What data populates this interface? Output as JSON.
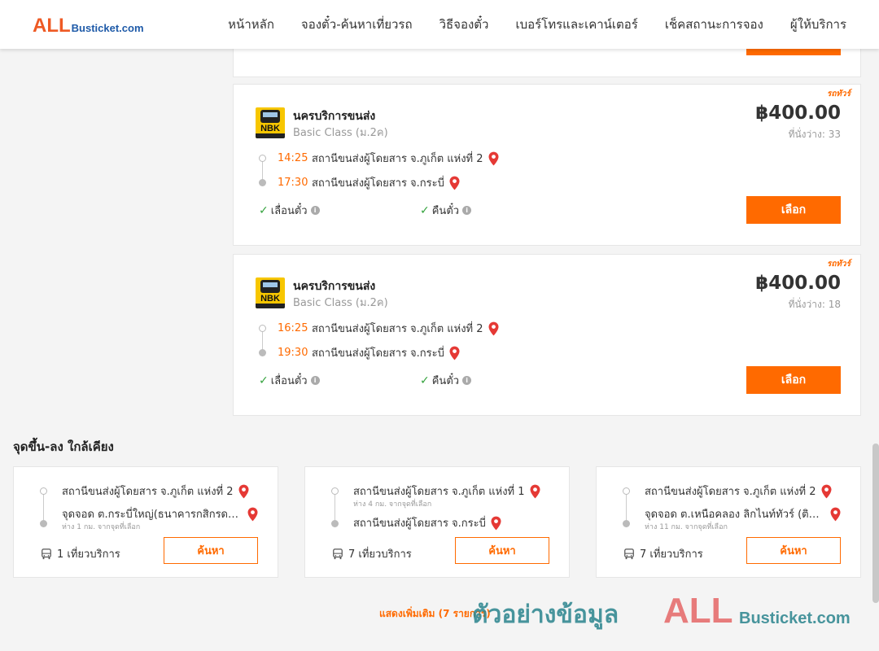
{
  "header": {
    "logo_all": "ALL",
    "logo_rest": "Busticket.com",
    "nav": [
      "หน้าหลัก",
      "จองตั๋ว-ค้นหาเที่ยวรถ",
      "วิธีจองตั๋ว",
      "เบอร์โทรและเคาน์เตอร์",
      "เช็คสถานะการจอง",
      "ผู้ให้บริการ"
    ]
  },
  "trips": [
    {
      "badge": "รถทัวร์",
      "operator": "นครบริการขนส่ง",
      "logo_text": "NBK",
      "bus_class": "Basic Class (ม.2ค)",
      "price": "฿400.00",
      "seats": "ที่นั่งว่าง: 33",
      "depart_time": "14:25",
      "depart_place": "สถานีขนส่งผู้โดยสาร จ.ภูเก็ต แห่งที่ 2",
      "arrive_time": "17:30",
      "arrive_place": "สถานีขนส่งผู้โดยสาร จ.กระบี่",
      "feature_1": "เลื่อนตั๋ว",
      "feature_2": "คืนตั๋ว",
      "select_label": "เลือก"
    },
    {
      "badge": "รถทัวร์",
      "operator": "นครบริการขนส่ง",
      "logo_text": "NBK",
      "bus_class": "Basic Class (ม.2ค)",
      "price": "฿400.00",
      "seats": "ที่นั่งว่าง: 18",
      "depart_time": "16:25",
      "depart_place": "สถานีขนส่งผู้โดยสาร จ.ภูเก็ต แห่งที่ 2",
      "arrive_time": "19:30",
      "arrive_place": "สถานีขนส่งผู้โดยสาร จ.กระบี่",
      "feature_1": "เลื่อนตั๋ว",
      "feature_2": "คืนตั๋ว",
      "select_label": "เลือก"
    }
  ],
  "nearby": {
    "title": "จุดขึ้น-ลง ใกล้เคียง",
    "cards": [
      {
        "from": "สถานีขนส่งผู้โดยสาร จ.ภูเก็ต แห่งที่ 2",
        "from_dist": "",
        "to": "จุดจอด ต.กระบี่ใหญ่(ธนาคารกสิกรดลาดเก่า)",
        "to_dist": "ห่าง 1 กม. จากจุดที่เลือก",
        "trips": "1 เที่ยวบริการ",
        "button": "ค้นหา"
      },
      {
        "from": "สถานีขนส่งผู้โดยสาร จ.ภูเก็ต แห่งที่ 1",
        "from_dist": "ห่าง 4 กม. จากจุดที่เลือก",
        "to": "สถานีขนส่งผู้โดยสาร จ.กระบี่",
        "to_dist": "",
        "trips": "7 เที่ยวบริการ",
        "button": "ค้นหา"
      },
      {
        "from": "สถานีขนส่งผู้โดยสาร จ.ภูเก็ต แห่งที่ 2",
        "from_dist": "",
        "to": "จุดจอด ต.เหนือคลอง ลิกไนท์ทัวร์ (ติดถนน)",
        "to_dist": "ห่าง 11 กม. จากจุดที่เลือก",
        "trips": "7 เที่ยวบริการ",
        "button": "ค้นหา"
      }
    ],
    "show_more": "แสดงเพิ่มเติม (7 รายการ)"
  },
  "watermark": {
    "thai": "ตัวอย่างข้อมูล",
    "all": "ALL",
    "rest": "Busticket.com"
  },
  "colors": {
    "accent": "#ff6a00",
    "check": "#35a33e",
    "pin": "#e53935"
  }
}
